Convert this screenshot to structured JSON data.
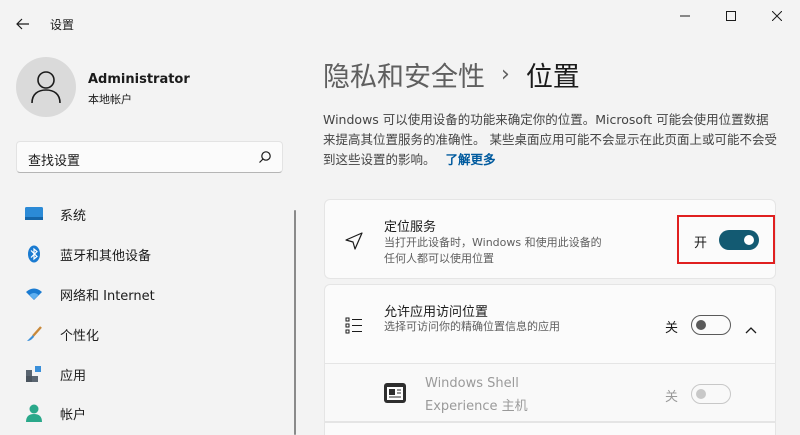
{
  "window": {
    "title": "设置"
  },
  "user": {
    "name": "Administrator",
    "account_type": "本地帐户"
  },
  "search": {
    "placeholder": "查找设置"
  },
  "sidebar": {
    "items": [
      {
        "label": "系统",
        "icon": "system-icon"
      },
      {
        "label": "蓝牙和其他设备",
        "icon": "bluetooth-icon"
      },
      {
        "label": "网络和 Internet",
        "icon": "wifi-icon"
      },
      {
        "label": "个性化",
        "icon": "brush-icon"
      },
      {
        "label": "应用",
        "icon": "apps-icon"
      },
      {
        "label": "帐户",
        "icon": "account-icon"
      }
    ]
  },
  "breadcrumb": {
    "parent": "隐私和安全性",
    "separator": "›",
    "current": "位置"
  },
  "description": {
    "text": "Windows 可以使用设备的功能来确定你的位置。Microsoft 可能会使用位置数据来提高其位置服务的准确性。 某些桌面应用可能不会显示在此页面上或可能不会受到这些设置的影响。",
    "link": "了解更多"
  },
  "location_services": {
    "title": "定位服务",
    "subtitle": "当打开此设备时，Windows 和使用此设备的任何人都可以使用位置",
    "state_label": "开",
    "on": true
  },
  "app_access": {
    "title": "允许应用访问位置",
    "subtitle": "选择可访问你的精确位置信息的应用",
    "state_label": "关",
    "on": false
  },
  "shell_app": {
    "title_line1": "Windows Shell",
    "title_line2": "Experience 主机",
    "state_label": "关",
    "on": false
  },
  "colors": {
    "accent": "#135a72",
    "link": "#005a9e",
    "highlight": "#e02020"
  }
}
